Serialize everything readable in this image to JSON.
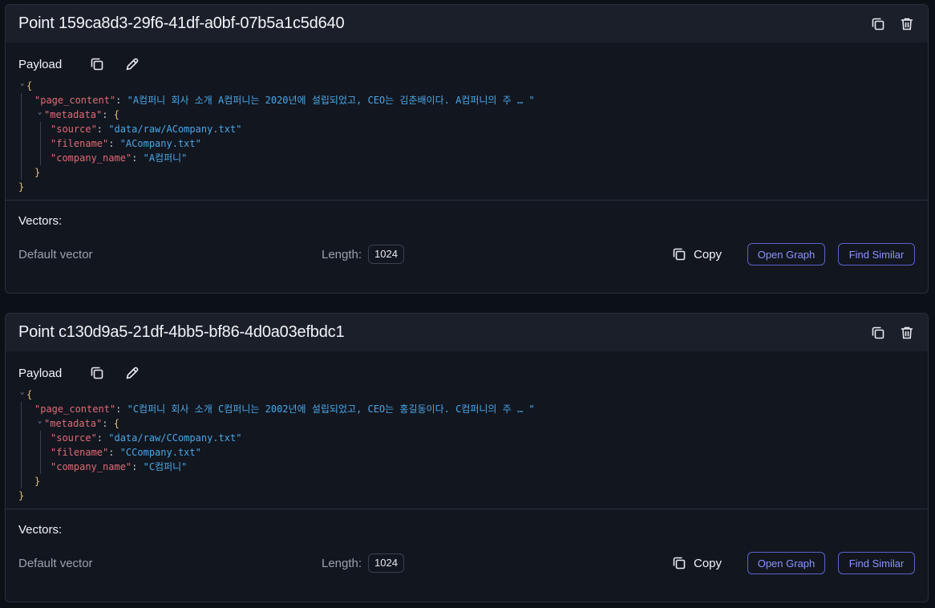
{
  "points": [
    {
      "title": "Point 159ca8d3-29f6-41df-a0bf-07b5a1c5d640",
      "payload_label": "Payload",
      "json": {
        "open_brace": "{",
        "close_brace": "}",
        "page_content_key": "\"page_content\"",
        "page_content_value": "\"A컴퍼니 회사 소개 A컴퍼니는 2020년에 설립되었고, CEO는 김춘배이다. A컴퍼니의 주 … \"",
        "metadata_key": "\"metadata\"",
        "source_key": "\"source\"",
        "source_value": "\"data/raw/ACompany.txt\"",
        "filename_key": "\"filename\"",
        "filename_value": "\"ACompany.txt\"",
        "company_name_key": "\"company_name\"",
        "company_name_value": "\"A컴퍼니\""
      },
      "vectors_label": "Vectors:",
      "vector_name": "Default vector",
      "length_label": "Length:",
      "length_value": "1024",
      "copy_label": "Copy",
      "open_graph_label": "Open Graph",
      "find_similar_label": "Find Similar"
    },
    {
      "title": "Point c130d9a5-21df-4bb5-bf86-4d0a03efbdc1",
      "payload_label": "Payload",
      "json": {
        "open_brace": "{",
        "close_brace": "}",
        "page_content_key": "\"page_content\"",
        "page_content_value": "\"C컴퍼니 회사 소개 C컴퍼니는 2002년에 설립되었고, CEO는 홍길동이다. C컴퍼니의 주 … \"",
        "metadata_key": "\"metadata\"",
        "source_key": "\"source\"",
        "source_value": "\"data/raw/CCompany.txt\"",
        "filename_key": "\"filename\"",
        "filename_value": "\"CCompany.txt\"",
        "company_name_key": "\"company_name\"",
        "company_name_value": "\"C컴퍼니\""
      },
      "vectors_label": "Vectors:",
      "vector_name": "Default vector",
      "length_label": "Length:",
      "length_value": "1024",
      "copy_label": "Copy",
      "open_graph_label": "Open Graph",
      "find_similar_label": "Find Similar"
    }
  ],
  "icons": {
    "copy": "copy-icon",
    "trash": "trash-icon",
    "edit": "pencil-icon",
    "chevron": "chevron-down-icon"
  },
  "colors": {
    "background": "#0c1017",
    "card": "#12161f",
    "card_header": "#1a1f29",
    "json_key": "#e06c75",
    "json_string": "#4aa8e8",
    "json_brace": "#e5c07b",
    "accent_button": "#8b93ff"
  }
}
